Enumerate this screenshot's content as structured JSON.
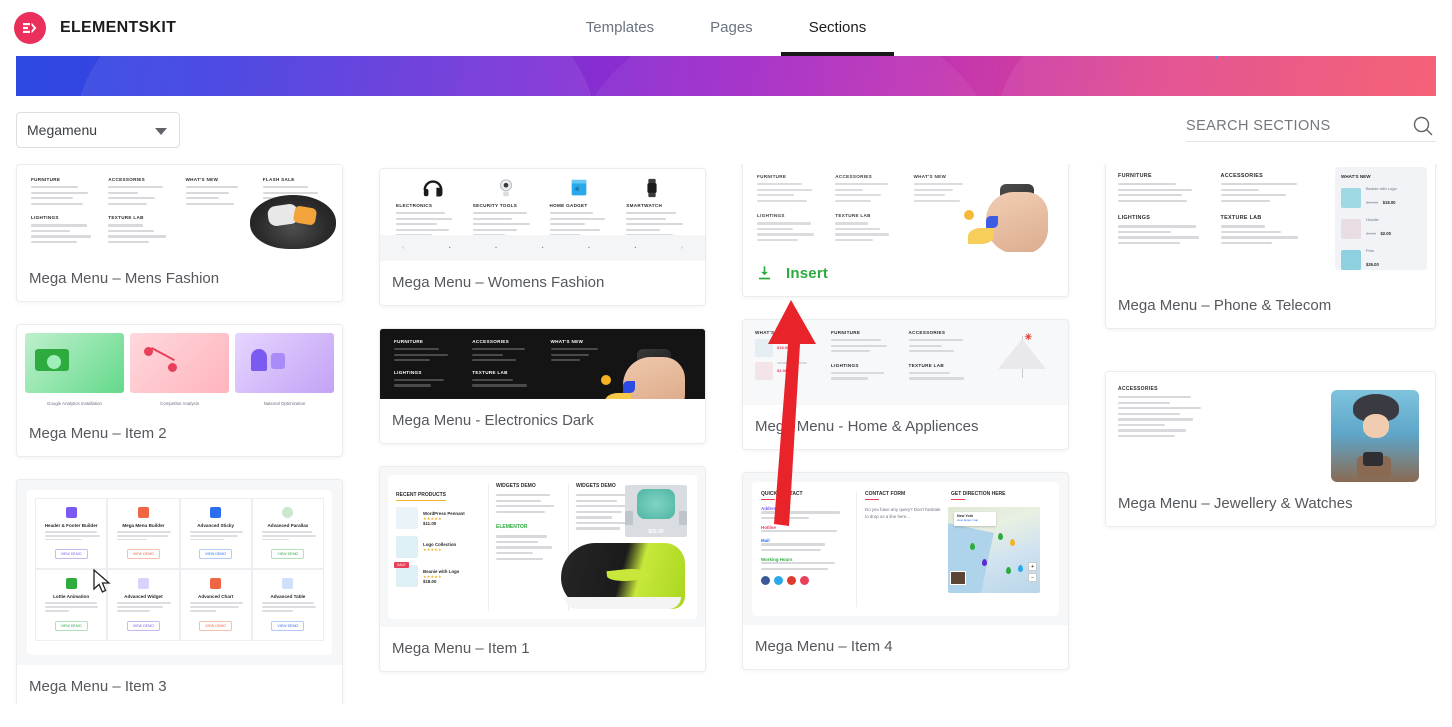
{
  "header": {
    "brand_name": "ELEMENTSKIT",
    "brand_mark": "EK",
    "brand_color": "#eb2f5b",
    "tabs": [
      {
        "label": "Templates",
        "active": false
      },
      {
        "label": "Pages",
        "active": false
      },
      {
        "label": "Sections",
        "active": true
      }
    ]
  },
  "banner": {
    "gradient_from": "#2b4be2",
    "gradient_mid": "#a229c8",
    "gradient_to": "#f5576c"
  },
  "toolbar": {
    "category_select": {
      "value": "Megamenu",
      "options": [
        "Megamenu"
      ]
    },
    "search": {
      "value": "",
      "placeholder": "SEARCH SECTIONS",
      "icon": "search-icon"
    }
  },
  "hover_state": {
    "card_index": 2,
    "insert_label": "Insert",
    "insert_icon": "download-icon",
    "insert_color": "#2eab3f"
  },
  "annotation": {
    "arrow_color": "#e8232a",
    "points_to": "Insert"
  },
  "grid": {
    "columns": [
      {
        "cards": [
          {
            "title": "Mega Menu – Mens Fashion",
            "thumb": "mega-menu-mens-fashion",
            "hovered": false
          },
          {
            "title": "Mega Menu – Item 2",
            "thumb": "mega-menu-item-2",
            "hovered": false
          },
          {
            "title": "Mega Menu – Item 3",
            "thumb": "mega-menu-item-3",
            "hovered": false
          }
        ]
      },
      {
        "cards": [
          {
            "title": "Mega Menu – Womens Fashion",
            "thumb": "mega-menu-womens-fashion",
            "hovered": false
          },
          {
            "title": "Mega Menu - Electronics Dark",
            "thumb": "mega-menu-electronics-dark",
            "hovered": false
          },
          {
            "title": "Mega Menu – Item 1",
            "thumb": "mega-menu-item-1",
            "hovered": false
          }
        ]
      },
      {
        "cards": [
          {
            "title": "Insert",
            "thumb": "mega-menu-speaker",
            "hovered": true
          },
          {
            "title": "Mega Menu - Home & Appliences",
            "thumb": "mega-menu-home-appliences",
            "hovered": false
          },
          {
            "title": "Mega Menu – Item 4",
            "thumb": "mega-menu-item-4",
            "hovered": false
          }
        ]
      },
      {
        "cards": [
          {
            "title": "Mega Menu – Phone & Telecom",
            "thumb": "mega-menu-phone-telecom",
            "hovered": false
          },
          {
            "title": "Mega Menu – Jewellery & Watches",
            "thumb": "mega-menu-jewellery-watches",
            "hovered": false
          }
        ]
      }
    ]
  },
  "thumbnail_content": {
    "menu_headings": [
      "FURNITURE",
      "ACCESSORIES",
      "WHAT'S NEW",
      "FLASH SALE",
      "LIGHTINGS",
      "TEXTURE LAB"
    ],
    "electronics_headings": [
      "ELECTRONICS",
      "SECURITY TOOLS",
      "HOME GADGET",
      "SMARTWATCH"
    ],
    "whats_new_items": [
      {
        "name": "Beanie with Logo",
        "old_price": "$24.00",
        "price": "$18.00"
      },
      {
        "name": "Hoodie",
        "old_price": "$4.00",
        "price": "$2.00"
      },
      {
        "name": "Polo",
        "old_price": "",
        "price": "$26.00"
      }
    ],
    "feature_cells": [
      {
        "title": "Header & Footer Builder",
        "cta": "VIEW DEMO",
        "color": "#7a5af0"
      },
      {
        "title": "Mega Menu Builder",
        "cta": "VIEW DEMO",
        "color": "#f06543"
      },
      {
        "title": "Advanced Sticky",
        "cta": "VIEW DEMO",
        "color": "#2b6ef0"
      },
      {
        "title": "Advanced Parallax",
        "cta": "VIEW DEMO",
        "color": "#2eab3f"
      },
      {
        "title": "Lottie Animation",
        "cta": "VIEW DEMO",
        "color": "#2eab3f"
      },
      {
        "title": "Advanced Widget",
        "cta": "VIEW DEMO",
        "color": "#7a5af0"
      },
      {
        "title": "Advanced Chart",
        "cta": "VIEW DEMO",
        "color": "#f06543"
      },
      {
        "title": "Advanced Table",
        "cta": "VIEW DEMO",
        "color": "#2b6ef0"
      }
    ],
    "item1_headings": [
      "RECENT PRODUCTS",
      "WIDGETS DEMO",
      "WIDGETS DEMO",
      "ELEMENTOR"
    ],
    "item1_products": [
      {
        "name": "WordPress Pennant",
        "price": "$11.00"
      },
      {
        "name": "Logo Collection",
        "price": ""
      },
      {
        "name": "Beanie with Logo",
        "price": "$18.00",
        "badge": "SALE"
      }
    ],
    "item1_feature_price": "$25.00",
    "item4_headings": [
      "QUICK CONTACT",
      "CONTACT FORM",
      "GET DIRECTION HERE"
    ],
    "item4_contact_rows": [
      "Address",
      "Hotline",
      "Mail",
      "Working Hours"
    ],
    "item4_form_text": "Do you have any query? Don't hesitate to drop us a line here...",
    "item4_map_label": "New York"
  }
}
